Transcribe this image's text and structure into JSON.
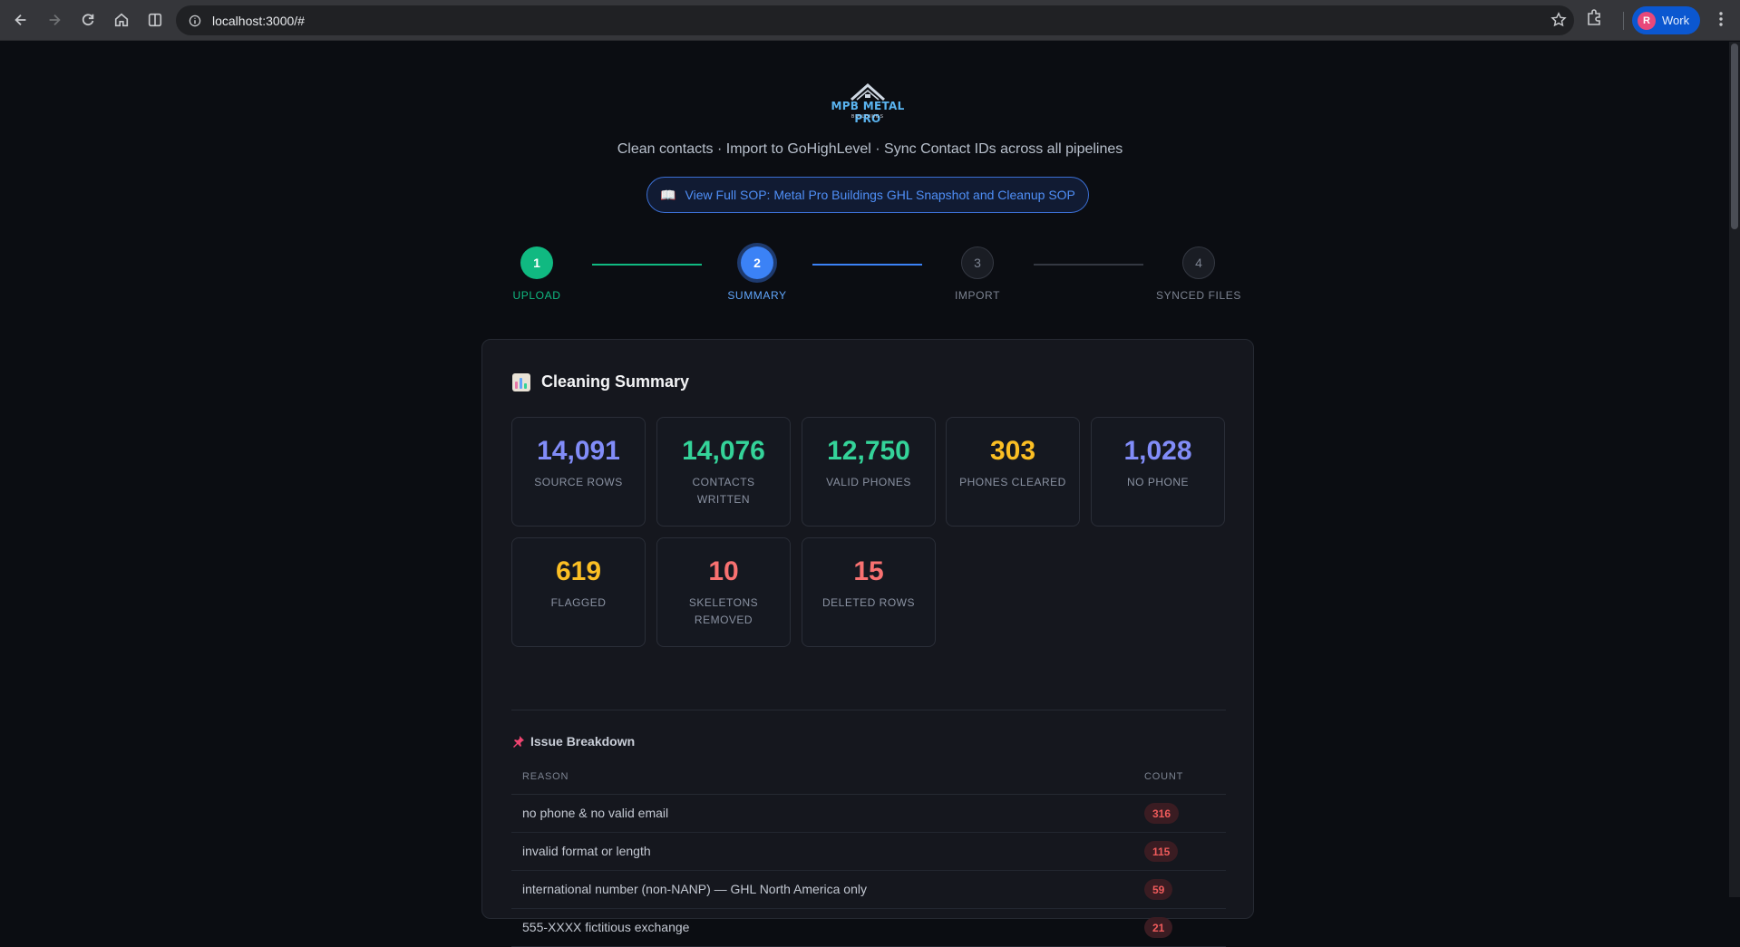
{
  "browser": {
    "url": "localhost:3000/#",
    "profile_initial": "R",
    "profile_name": "Work"
  },
  "header": {
    "logo_text": "MPB METAL PRO",
    "logo_sub": "BUILDINGS",
    "tagline": "Clean contacts · Import to GoHighLevel · Sync Contact IDs across all pipelines",
    "sop_icon": "📖",
    "sop_label": "View Full SOP: Metal Pro Buildings GHL Snapshot and Cleanup SOP"
  },
  "stepper": {
    "steps": [
      {
        "number": "1",
        "label": "UPLOAD",
        "state": "done"
      },
      {
        "number": "2",
        "label": "SUMMARY",
        "state": "active"
      },
      {
        "number": "3",
        "label": "IMPORT",
        "state": "pending"
      },
      {
        "number": "4",
        "label": "SYNCED FILES",
        "state": "pending"
      }
    ],
    "connector_colors": [
      "#10b981",
      "#3b82f6",
      "#343842"
    ]
  },
  "summary": {
    "title": "Cleaning Summary",
    "stats": [
      {
        "value": "14,091",
        "label": "SOURCE ROWS",
        "color": "#818cf8"
      },
      {
        "value": "14,076",
        "label": "CONTACTS WRITTEN",
        "color": "#34d399"
      },
      {
        "value": "12,750",
        "label": "VALID PHONES",
        "color": "#34d399"
      },
      {
        "value": "303",
        "label": "PHONES CLEARED",
        "color": "#fbbf24"
      },
      {
        "value": "1,028",
        "label": "NO PHONE",
        "color": "#818cf8"
      },
      {
        "value": "619",
        "label": "FLAGGED",
        "color": "#fbbf24"
      },
      {
        "value": "10",
        "label": "SKELETONS REMOVED",
        "color": "#f87171"
      },
      {
        "value": "15",
        "label": "DELETED ROWS",
        "color": "#f87171"
      }
    ]
  },
  "issues": {
    "title": "Issue Breakdown",
    "col_reason": "REASON",
    "col_count": "COUNT",
    "rows": [
      {
        "reason": "no phone & no valid email",
        "count": "316"
      },
      {
        "reason": "invalid format or length",
        "count": "115"
      },
      {
        "reason": "international number (non-NANP) — GHL North America only",
        "count": "59"
      },
      {
        "reason": "555-XXXX fictitious exchange",
        "count": "21"
      }
    ]
  }
}
